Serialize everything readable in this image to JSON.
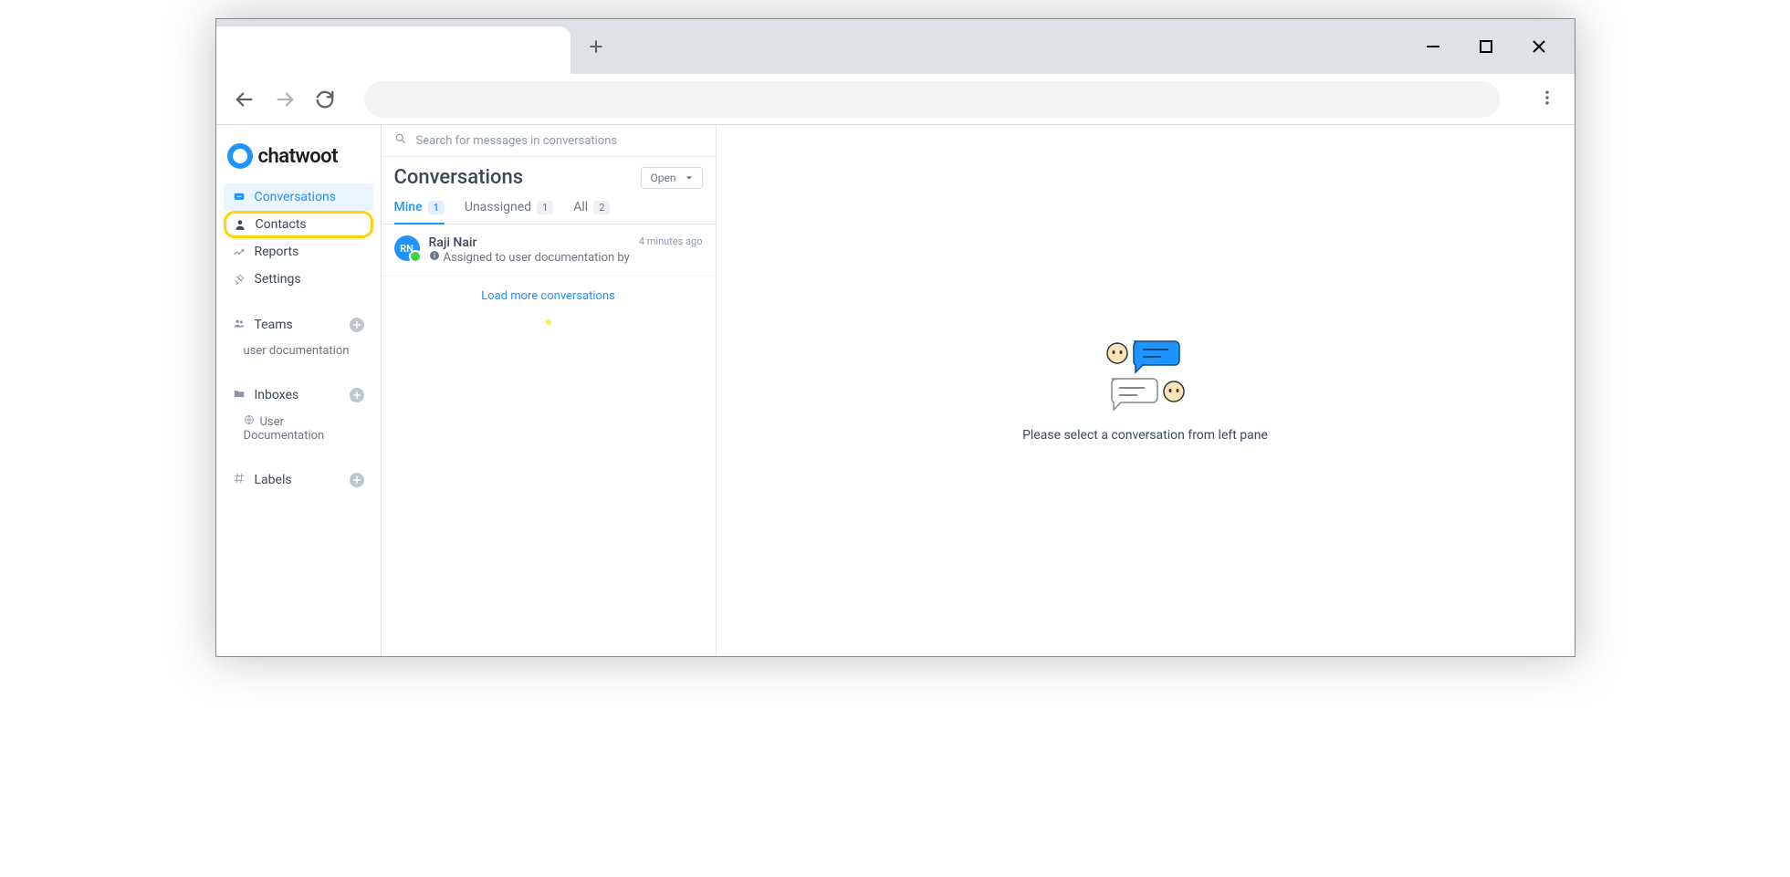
{
  "logo": {
    "text": "chatwoot"
  },
  "sidebar": {
    "nav": [
      {
        "label": "Conversations"
      },
      {
        "label": "Contacts"
      },
      {
        "label": "Reports"
      },
      {
        "label": "Settings"
      }
    ],
    "sections": {
      "teams": {
        "label": "Teams",
        "items": [
          "user documentation"
        ]
      },
      "inboxes": {
        "label": "Inboxes",
        "items": [
          "User Documentation"
        ]
      },
      "labels": {
        "label": "Labels"
      }
    }
  },
  "midpanel": {
    "search_placeholder": "Search for messages in conversations",
    "title": "Conversations",
    "status": "Open",
    "tabs": [
      {
        "label": "Mine",
        "count": "1"
      },
      {
        "label": "Unassigned",
        "count": "1"
      },
      {
        "label": "All",
        "count": "2"
      }
    ],
    "conversation": {
      "initials": "RN",
      "name": "Raji Nair",
      "snippet": "Assigned to user documentation by ...",
      "time": "4 minutes ago"
    },
    "load_more": "Load more conversations"
  },
  "mainpanel": {
    "empty_text": "Please select a conversation from left pane"
  }
}
